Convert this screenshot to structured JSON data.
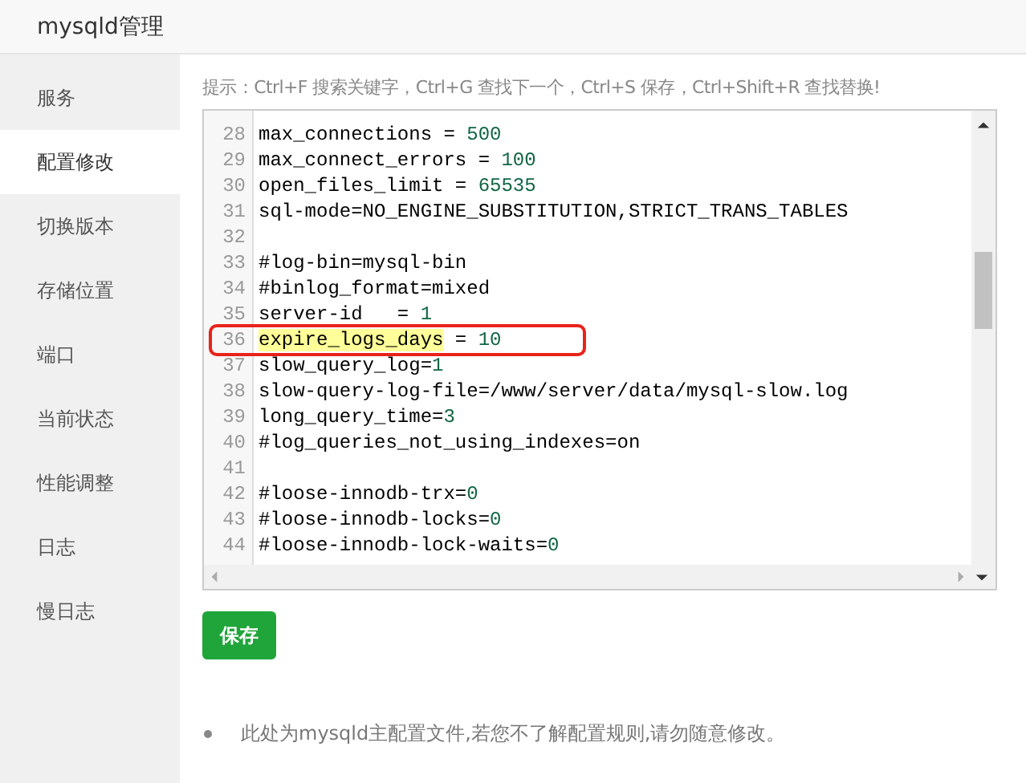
{
  "window": {
    "title": "mysqld管理"
  },
  "sidebar": {
    "items": [
      {
        "label": "服务",
        "selected": false
      },
      {
        "label": "配置修改",
        "selected": true
      },
      {
        "label": "切换版本",
        "selected": false
      },
      {
        "label": "存储位置",
        "selected": false
      },
      {
        "label": "端口",
        "selected": false
      },
      {
        "label": "当前状态",
        "selected": false
      },
      {
        "label": "性能调整",
        "selected": false
      },
      {
        "label": "日志",
        "selected": false
      },
      {
        "label": "慢日志",
        "selected": false
      }
    ]
  },
  "hint": "提示：Ctrl+F 搜索关键字，Ctrl+G 查找下一个，Ctrl+S 保存，Ctrl+Shift+R 查找替换!",
  "editor": {
    "lines": [
      {
        "number": "28",
        "marked": false,
        "parts": [
          {
            "kind": "plain",
            "text": "max_connections = "
          },
          {
            "kind": "number",
            "text": "500"
          }
        ]
      },
      {
        "number": "29",
        "marked": false,
        "parts": [
          {
            "kind": "plain",
            "text": "max_connect_errors = "
          },
          {
            "kind": "number",
            "text": "100"
          }
        ]
      },
      {
        "number": "30",
        "marked": false,
        "parts": [
          {
            "kind": "plain",
            "text": "open_files_limit = "
          },
          {
            "kind": "number",
            "text": "65535"
          }
        ]
      },
      {
        "number": "31",
        "marked": false,
        "parts": [
          {
            "kind": "plain",
            "text": "sql-mode=NO_ENGINE_SUBSTITUTION,STRICT_TRANS_TABLES"
          }
        ]
      },
      {
        "number": "32"
      },
      {
        "number": "33",
        "marked": false,
        "parts": [
          {
            "kind": "plain",
            "text": "#log-bin=mysql-bin"
          }
        ]
      },
      {
        "number": "34",
        "marked": false,
        "parts": [
          {
            "kind": "plain",
            "text": "#binlog_format=mixed"
          }
        ]
      },
      {
        "number": "35",
        "marked": false,
        "parts": [
          {
            "kind": "plain",
            "text": "server-id   = "
          },
          {
            "kind": "number",
            "text": "1"
          }
        ]
      },
      {
        "number": "36",
        "marked": true,
        "parts": [
          {
            "kind": "match",
            "text": "expire_logs_days"
          },
          {
            "kind": "plain",
            "text": " = "
          },
          {
            "kind": "number",
            "text": "10"
          }
        ]
      },
      {
        "number": "37",
        "marked": false,
        "parts": [
          {
            "kind": "plain",
            "text": "slow_query_log="
          },
          {
            "kind": "number",
            "text": "1"
          }
        ]
      },
      {
        "number": "38",
        "marked": false,
        "parts": [
          {
            "kind": "plain",
            "text": "slow-query-log-file=/www/server/data/mysql-slow.log"
          }
        ]
      },
      {
        "number": "39",
        "marked": false,
        "parts": [
          {
            "kind": "plain",
            "text": "long_query_time="
          },
          {
            "kind": "number",
            "text": "3"
          }
        ]
      },
      {
        "number": "40",
        "marked": false,
        "parts": [
          {
            "kind": "plain",
            "text": "#log_queries_not_using_indexes=on"
          }
        ]
      },
      {
        "number": "41"
      },
      {
        "number": "42",
        "marked": false,
        "parts": [
          {
            "kind": "plain",
            "text": "#loose-innodb-trx="
          },
          {
            "kind": "number",
            "text": "0"
          }
        ]
      },
      {
        "number": "43",
        "marked": false,
        "parts": [
          {
            "kind": "plain",
            "text": "#loose-innodb-locks="
          },
          {
            "kind": "number",
            "text": "0"
          }
        ]
      },
      {
        "number": "44",
        "marked": false,
        "parts": [
          {
            "kind": "plain",
            "text": "#loose-innodb-lock-waits="
          },
          {
            "kind": "number",
            "text": "0"
          }
        ]
      }
    ]
  },
  "save_button": "保存",
  "notes": [
    "此处为mysqld主配置文件,若您不了解配置规则,请勿随意修改。"
  ]
}
